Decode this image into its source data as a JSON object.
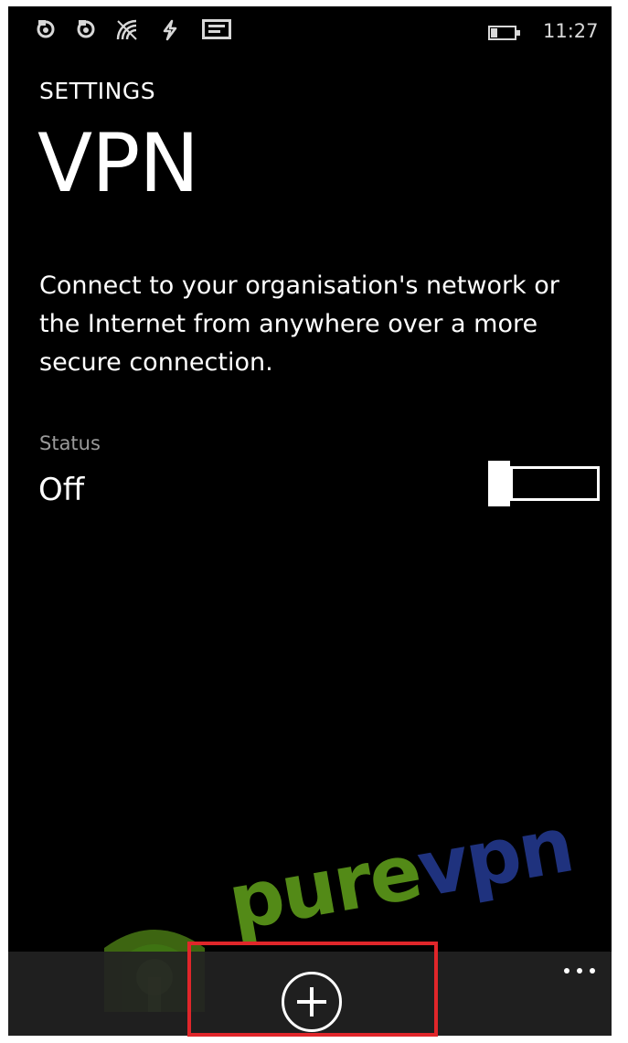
{
  "status_bar": {
    "icons": [
      "sync-icon",
      "sync-icon",
      "wifi-icon",
      "data-transfer-icon",
      "message-icon",
      "battery-icon"
    ],
    "time": "11:27"
  },
  "header": {
    "section": "SETTINGS",
    "title": "VPN"
  },
  "description": "Connect to your organisation's network or the Internet from anywhere over a more secure connection.",
  "status": {
    "label": "Status",
    "value": "Off",
    "toggle_on": false
  },
  "watermark": {
    "brand_part1": "pure",
    "brand_part2": "vpn",
    "colors": {
      "pure": "#6fb81f",
      "vpn": "#2a43a8"
    }
  },
  "app_bar": {
    "buttons": [
      "add-icon",
      "more-icon"
    ],
    "highlight_color": "#e0262a"
  }
}
